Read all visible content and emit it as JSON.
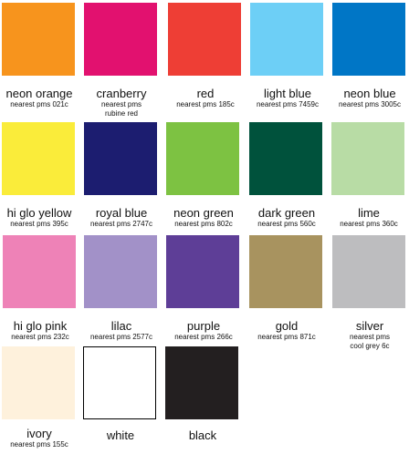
{
  "swatches": [
    {
      "name": "neon orange",
      "pms": "nearest pms 021c",
      "pms2": "",
      "color": "#F7941D"
    },
    {
      "name": "cranberry",
      "pms": "nearest pms",
      "pms2": "rubine red",
      "color": "#E2116F"
    },
    {
      "name": "red",
      "pms": "nearest pms 185c",
      "pms2": "",
      "color": "#EE3E35"
    },
    {
      "name": "light blue",
      "pms": "nearest pms 7459c",
      "pms2": "",
      "color": "#6DCFF6"
    },
    {
      "name": "neon blue",
      "pms": "nearest pms 3005c",
      "pms2": "",
      "color": "#0076C6"
    },
    {
      "name": "hi glo yellow",
      "pms": "nearest pms 395c",
      "pms2": "",
      "color": "#FAEC3A"
    },
    {
      "name": "royal blue",
      "pms": "nearest pms 2747c",
      "pms2": "",
      "color": "#1C1D70"
    },
    {
      "name": "neon green",
      "pms": "nearest pms 802c",
      "pms2": "",
      "color": "#7DC242"
    },
    {
      "name": "dark green",
      "pms": "nearest pms 560c",
      "pms2": "",
      "color": "#00523C"
    },
    {
      "name": "lime",
      "pms": "nearest pms 360c",
      "pms2": "",
      "color": "#B8DCA5"
    },
    {
      "name": "hi glo pink",
      "pms": "nearest pms 232c",
      "pms2": "",
      "color": "#EE82B7"
    },
    {
      "name": "lilac",
      "pms": "nearest pms 2577c",
      "pms2": "",
      "color": "#A291C8"
    },
    {
      "name": "purple",
      "pms": "nearest pms 266c",
      "pms2": "",
      "color": "#5E3E97"
    },
    {
      "name": "gold",
      "pms": "nearest pms 871c",
      "pms2": "",
      "color": "#A8935F"
    },
    {
      "name": "silver",
      "pms": "nearest pms",
      "pms2": "cool grey 6c",
      "color": "#BDBDBF"
    },
    {
      "name": "ivory",
      "pms": "nearest pms 155c",
      "pms2": "",
      "color": "#FEF1DC"
    },
    {
      "name": "white",
      "pms": "",
      "pms2": "",
      "color": "#FFFFFF"
    },
    {
      "name": "black",
      "pms": "",
      "pms2": "",
      "color": "#231F20"
    }
  ]
}
